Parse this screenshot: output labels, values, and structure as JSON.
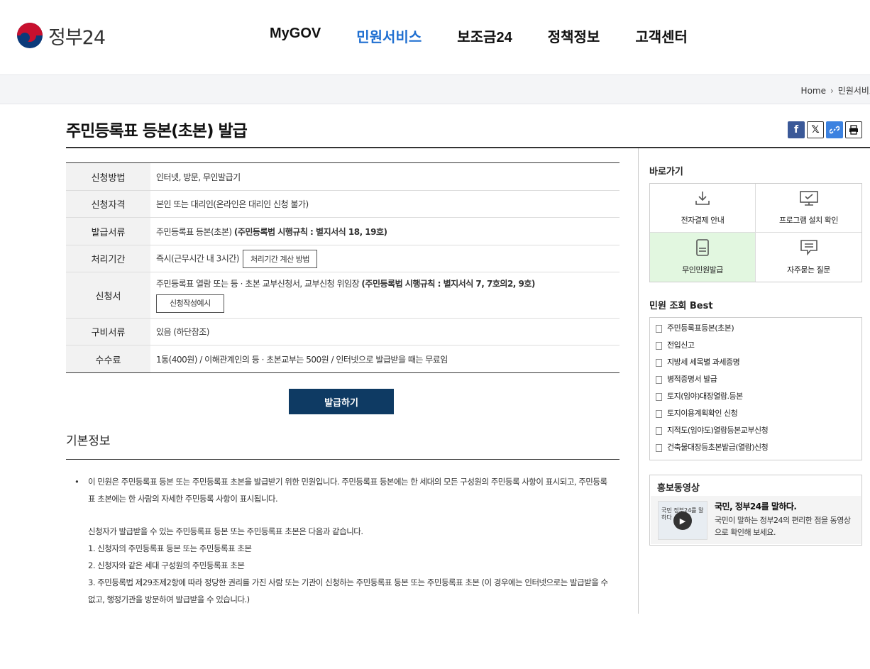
{
  "header": {
    "logo_text": "정부24",
    "nav": [
      {
        "label": "MyGOV"
      },
      {
        "label": "민원서비스",
        "active": true
      },
      {
        "label": "보조금24"
      },
      {
        "label": "정책정보"
      },
      {
        "label": "고객센터"
      }
    ]
  },
  "breadcrumb": {
    "home": "Home",
    "current": "민원서비스"
  },
  "page": {
    "title": "주민등록표 등본(초본) 발급"
  },
  "share": {
    "facebook": "f",
    "x": "𝕏",
    "link": "🔗",
    "print": "🖶"
  },
  "info": {
    "method_label": "신청방법",
    "method_value": "인터넷, 방문, 무인발급기",
    "qual_label": "신청자격",
    "qual_value": "본인 또는 대리인(온라인은 대리인 신청 불가)",
    "docs_label": "발급서류",
    "docs_value": "주민등록표 등본(초본) ",
    "docs_bold": "(주민등록법 시행규칙 : 별지서식 18, 19호)",
    "period_label": "처리기간",
    "period_value": "즉시(근무시간 내 3시간)",
    "period_btn": "처리기간 계산 방법",
    "form_label": "신청서",
    "form_value": "주민등록표 열람 또는 등 · 초본 교부신청서, 교부신청 위임장 ",
    "form_bold": "(주민등록법 시행규칙 : 별지서식 7, 7호의2, 9호)",
    "form_btn": "신청작성예시",
    "req_label": "구비서류",
    "req_value": "있음 (하단참조)",
    "fee_label": "수수료",
    "fee_value": "1통(400원) / 이해관계인의 등 · 초본교부는 500원 / 인터넷으로 발급받을 때는 무료임"
  },
  "issue_button": "발급하기",
  "basic": {
    "heading": "기본정보",
    "para1": "이 민원은 주민등록표 등본 또는 주민등록표 초본을 발급받기 위한 민원입니다. 주민등록표 등본에는 한 세대의 모든 구성원의 주민등록 사항이 표시되고, 주민등록표 초본에는 한 사람의 자세한 주민등록 사항이 표시됩니다.",
    "line1": "신청자가 발급받을 수 있는 주민등록표 등본 또는 주민등록표 초본은 다음과 같습니다.",
    "line2": "1. 신청자의 주민등록표 등본 또는 주민등록표 초본",
    "line3": "2. 신청자와 같은 세대 구성원의 주민등록표 초본",
    "line4": "3. 주민등록법 제29조제2항에 따라 정당한 권리를 가진 사람 또는 기관이 신청하는 주민등록표 등본 또는 주민등록표 초본 (이 경우에는 인터넷으로는 발급받을 수 없고, 행정기관을 방문하여 발급받을 수 있습니다.)"
  },
  "sidebar": {
    "quick_heading": "바로가기",
    "quick": [
      {
        "label": "전자결제 안내",
        "icon": "download-icon"
      },
      {
        "label": "프로그램 설치 확인",
        "icon": "monitor-check-icon"
      },
      {
        "label": "무인민원발급",
        "icon": "kiosk-icon"
      },
      {
        "label": "자주묻는 질문",
        "icon": "chat-icon"
      }
    ],
    "best_heading": "민원 조회 Best",
    "best": [
      "주민등록표등본(초본)",
      "전입신고",
      "지방세 세목별 과세증명",
      "병적증명서 발급",
      "토지(임야)대장열람.등본",
      "토지이용계획확인 신청",
      "지적도(임야도)열람등본교부신청",
      "건축물대장등초본발급(열람)신청"
    ],
    "promo_heading": "홍보동영상",
    "promo_title": "국민, 정부24를 말하다.",
    "promo_desc": "국민이 말하는 정부24의 편리한 점을 동영상으로 확인해 보세요.",
    "promo_thumb_text": "국민 정부24를 말하다"
  }
}
